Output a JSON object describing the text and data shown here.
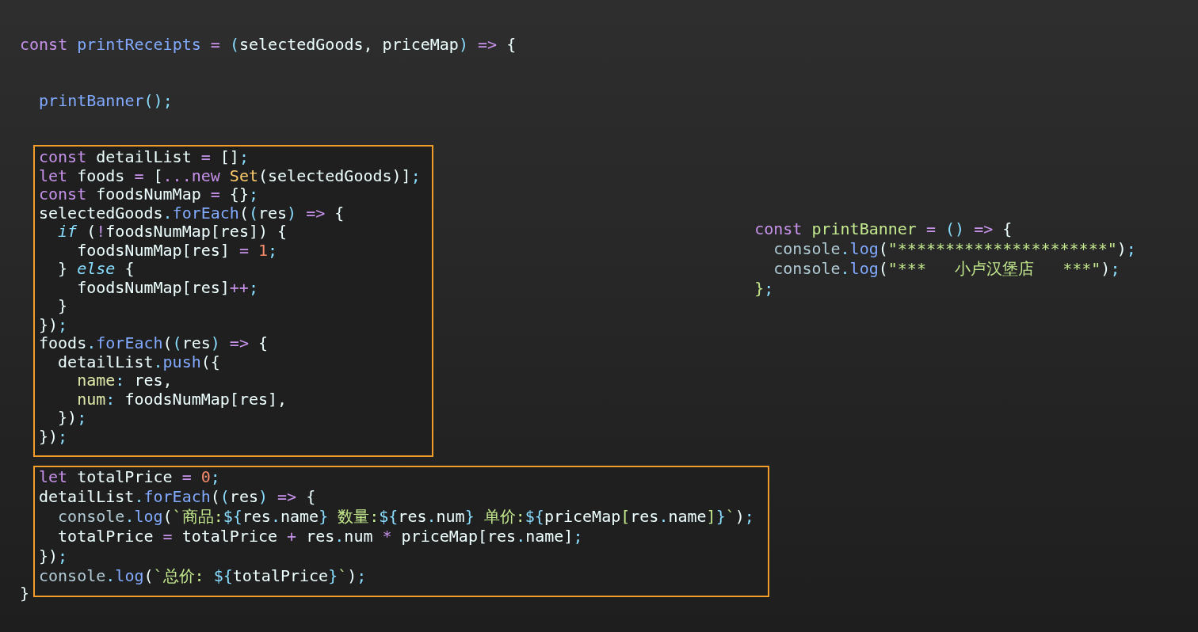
{
  "main_function": {
    "header": [
      [
        {
          "kind": "keyword",
          "text": "const "
        },
        {
          "kind": "function",
          "text": "printReceipts"
        },
        {
          "kind": "operator",
          "text": " = "
        },
        {
          "kind": "punct",
          "text": "("
        },
        {
          "kind": "plain",
          "text": "selectedGoods, priceMap"
        },
        {
          "kind": "punct",
          "text": ")"
        },
        {
          "kind": "operator",
          "text": " => "
        },
        {
          "kind": "plain",
          "text": "{"
        }
      ],
      [
        {
          "kind": "function",
          "text": "  printBanner"
        },
        {
          "kind": "punct",
          "text": "();"
        }
      ]
    ],
    "highlighted_blocks": [
      {
        "lines": [
          [
            {
              "kind": "keyword",
              "text": "const"
            },
            {
              "kind": "plain",
              "text": " detailList "
            },
            {
              "kind": "operator",
              "text": "="
            },
            {
              "kind": "plain",
              "text": " []"
            },
            {
              "kind": "punct",
              "text": ";"
            }
          ],
          [
            {
              "kind": "keyword",
              "text": "let"
            },
            {
              "kind": "plain",
              "text": " foods "
            },
            {
              "kind": "operator",
              "text": "="
            },
            {
              "kind": "plain",
              "text": " ["
            },
            {
              "kind": "operator",
              "text": "...new "
            },
            {
              "kind": "class",
              "text": "Set"
            },
            {
              "kind": "plain",
              "text": "(selectedGoods)]"
            },
            {
              "kind": "punct",
              "text": ";"
            }
          ],
          [
            {
              "kind": "keyword",
              "text": "const"
            },
            {
              "kind": "plain",
              "text": " foodsNumMap "
            },
            {
              "kind": "operator",
              "text": "="
            },
            {
              "kind": "plain",
              "text": " {}"
            },
            {
              "kind": "punct",
              "text": ";"
            }
          ],
          [
            {
              "kind": "plain",
              "text": "selectedGoods"
            },
            {
              "kind": "punct",
              "text": "."
            },
            {
              "kind": "function",
              "text": "forEach"
            },
            {
              "kind": "plain",
              "text": "("
            },
            {
              "kind": "punct",
              "text": "("
            },
            {
              "kind": "plain",
              "text": "res"
            },
            {
              "kind": "punct",
              "text": ")"
            },
            {
              "kind": "operator",
              "text": " => "
            },
            {
              "kind": "plain",
              "text": "{"
            }
          ],
          [
            {
              "kind": "control",
              "text": "  if"
            },
            {
              "kind": "plain",
              "text": " ("
            },
            {
              "kind": "operator",
              "text": "!"
            },
            {
              "kind": "plain",
              "text": "foodsNumMap[res]) {"
            }
          ],
          [
            {
              "kind": "plain",
              "text": "    foodsNumMap[res] "
            },
            {
              "kind": "operator",
              "text": "= "
            },
            {
              "kind": "number",
              "text": "1"
            },
            {
              "kind": "punct",
              "text": ";"
            }
          ],
          [
            {
              "kind": "plain",
              "text": "  } "
            },
            {
              "kind": "control",
              "text": "else"
            },
            {
              "kind": "plain",
              "text": " {"
            }
          ],
          [
            {
              "kind": "plain",
              "text": "    foodsNumMap[res]"
            },
            {
              "kind": "operator",
              "text": "++"
            },
            {
              "kind": "punct",
              "text": ";"
            }
          ],
          [
            {
              "kind": "plain",
              "text": "  }"
            }
          ],
          [
            {
              "kind": "plain",
              "text": "})"
            },
            {
              "kind": "punct",
              "text": ";"
            }
          ],
          [
            {
              "kind": "plain",
              "text": "foods"
            },
            {
              "kind": "punct",
              "text": "."
            },
            {
              "kind": "function",
              "text": "forEach"
            },
            {
              "kind": "plain",
              "text": "("
            },
            {
              "kind": "punct",
              "text": "("
            },
            {
              "kind": "plain",
              "text": "res"
            },
            {
              "kind": "punct",
              "text": ")"
            },
            {
              "kind": "operator",
              "text": " => "
            },
            {
              "kind": "plain",
              "text": "{"
            }
          ],
          [
            {
              "kind": "plain",
              "text": "  detailList"
            },
            {
              "kind": "punct",
              "text": "."
            },
            {
              "kind": "function",
              "text": "push"
            },
            {
              "kind": "plain",
              "text": "({"
            }
          ],
          [
            {
              "kind": "property",
              "text": "    name"
            },
            {
              "kind": "punct",
              "text": ":"
            },
            {
              "kind": "plain",
              "text": " res,"
            }
          ],
          [
            {
              "kind": "property",
              "text": "    num"
            },
            {
              "kind": "punct",
              "text": ":"
            },
            {
              "kind": "plain",
              "text": " foodsNumMap[res],"
            }
          ],
          [
            {
              "kind": "plain",
              "text": "  })"
            },
            {
              "kind": "punct",
              "text": ";"
            }
          ],
          [
            {
              "kind": "plain",
              "text": "})"
            },
            {
              "kind": "punct",
              "text": ";"
            }
          ]
        ]
      },
      {
        "lines": [
          [
            {
              "kind": "keyword",
              "text": "let"
            },
            {
              "kind": "plain",
              "text": " totalPrice "
            },
            {
              "kind": "operator",
              "text": "= "
            },
            {
              "kind": "number",
              "text": "0"
            },
            {
              "kind": "punct",
              "text": ";"
            }
          ],
          [
            {
              "kind": "plain",
              "text": "detailList"
            },
            {
              "kind": "punct",
              "text": "."
            },
            {
              "kind": "function",
              "text": "forEach"
            },
            {
              "kind": "plain",
              "text": "("
            },
            {
              "kind": "punct",
              "text": "("
            },
            {
              "kind": "plain",
              "text": "res"
            },
            {
              "kind": "punct",
              "text": ")"
            },
            {
              "kind": "operator",
              "text": " => "
            },
            {
              "kind": "plain",
              "text": "{"
            }
          ],
          [
            {
              "kind": "object",
              "text": "  console"
            },
            {
              "kind": "punct",
              "text": "."
            },
            {
              "kind": "function",
              "text": "log"
            },
            {
              "kind": "plain",
              "text": "("
            },
            {
              "kind": "string",
              "text": "`商品:"
            },
            {
              "kind": "punct",
              "text": "${"
            },
            {
              "kind": "plain",
              "text": "res"
            },
            {
              "kind": "punct",
              "text": "."
            },
            {
              "kind": "plain",
              "text": "name"
            },
            {
              "kind": "punct",
              "text": "}"
            },
            {
              "kind": "string",
              "text": " 数量:"
            },
            {
              "kind": "punct",
              "text": "${"
            },
            {
              "kind": "plain",
              "text": "res"
            },
            {
              "kind": "punct",
              "text": "."
            },
            {
              "kind": "plain",
              "text": "num"
            },
            {
              "kind": "punct",
              "text": "}"
            },
            {
              "kind": "string",
              "text": " 单价:"
            },
            {
              "kind": "punct",
              "text": "${"
            },
            {
              "kind": "plain",
              "text": "priceMap"
            },
            {
              "kind": "string",
              "text": "["
            },
            {
              "kind": "plain",
              "text": "res"
            },
            {
              "kind": "punct",
              "text": "."
            },
            {
              "kind": "plain",
              "text": "name"
            },
            {
              "kind": "string",
              "text": "]"
            },
            {
              "kind": "punct",
              "text": "}"
            },
            {
              "kind": "string",
              "text": "`"
            },
            {
              "kind": "plain",
              "text": ")"
            },
            {
              "kind": "punct",
              "text": ";"
            }
          ],
          [
            {
              "kind": "plain",
              "text": "  totalPrice "
            },
            {
              "kind": "operator",
              "text": "="
            },
            {
              "kind": "plain",
              "text": " totalPrice "
            },
            {
              "kind": "operator",
              "text": "+"
            },
            {
              "kind": "plain",
              "text": " res"
            },
            {
              "kind": "punct",
              "text": "."
            },
            {
              "kind": "plain",
              "text": "num "
            },
            {
              "kind": "operator",
              "text": "*"
            },
            {
              "kind": "plain",
              "text": " priceMap[res"
            },
            {
              "kind": "punct",
              "text": "."
            },
            {
              "kind": "plain",
              "text": "name]"
            },
            {
              "kind": "punct",
              "text": ";"
            }
          ],
          [
            {
              "kind": "plain",
              "text": "})"
            },
            {
              "kind": "punct",
              "text": ";"
            }
          ],
          [
            {
              "kind": "object",
              "text": "console"
            },
            {
              "kind": "punct",
              "text": "."
            },
            {
              "kind": "function",
              "text": "log"
            },
            {
              "kind": "plain",
              "text": "("
            },
            {
              "kind": "string",
              "text": "`总价: "
            },
            {
              "kind": "punct",
              "text": "${"
            },
            {
              "kind": "plain",
              "text": "totalPrice"
            },
            {
              "kind": "punct",
              "text": "}"
            },
            {
              "kind": "string",
              "text": "`"
            },
            {
              "kind": "plain",
              "text": ")"
            },
            {
              "kind": "punct",
              "text": ";"
            }
          ]
        ]
      }
    ],
    "footer": [
      [
        {
          "kind": "plain",
          "text": "}"
        }
      ]
    ]
  },
  "banner_function": {
    "lines": [
      [
        {
          "kind": "keyword",
          "text": "const "
        },
        {
          "kind": "declaration",
          "text": "printBanner"
        },
        {
          "kind": "operator",
          "text": " = "
        },
        {
          "kind": "punct",
          "text": "()"
        },
        {
          "kind": "operator",
          "text": " => "
        },
        {
          "kind": "plain",
          "text": "{"
        }
      ],
      [
        {
          "kind": "object",
          "text": "  console"
        },
        {
          "kind": "punct",
          "text": "."
        },
        {
          "kind": "function",
          "text": "log"
        },
        {
          "kind": "plain",
          "text": "("
        },
        {
          "kind": "string",
          "text": "\"**********************\""
        },
        {
          "kind": "plain",
          "text": ")"
        },
        {
          "kind": "punct",
          "text": ";"
        }
      ],
      [
        {
          "kind": "object",
          "text": "  console"
        },
        {
          "kind": "punct",
          "text": "."
        },
        {
          "kind": "function",
          "text": "log"
        },
        {
          "kind": "plain",
          "text": "("
        },
        {
          "kind": "string",
          "text": "\"***   小卢汉堡店   ***\""
        },
        {
          "kind": "plain",
          "text": ")"
        },
        {
          "kind": "punct",
          "text": ";"
        }
      ],
      [
        {
          "kind": "declaration",
          "text": "}"
        },
        {
          "kind": "punct",
          "text": ";"
        }
      ]
    ]
  }
}
